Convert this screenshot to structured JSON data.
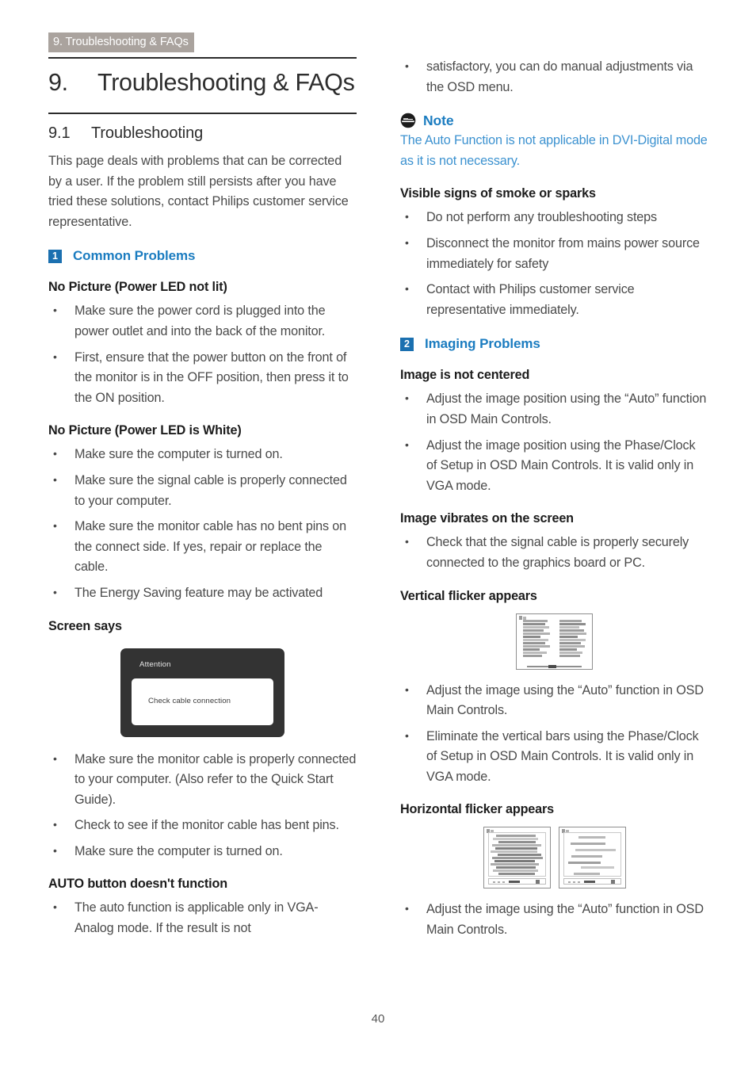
{
  "header": {
    "running_header": "9. Troubleshooting & FAQs",
    "chapter_number": "9.",
    "chapter_title": "Troubleshooting & FAQs",
    "section_number": "9.1",
    "section_title": "Troubleshooting"
  },
  "colors": {
    "accent_blue": "#1b7cc0",
    "badge_blue": "#1b70b0",
    "note_body_blue": "#3c92d0",
    "header_band_gray": "#aaa39e",
    "body_text": "#4a4a4a",
    "heading_black": "#1c1c1c",
    "dialog_dark": "#333333"
  },
  "left_column": {
    "intro": "This page deals with problems that can be corrected by a user. If the problem still persists after you have tried these solutions, contact Philips customer service representative.",
    "common_problems": {
      "badge": "1",
      "label": "Common Problems"
    },
    "no_picture_led_not_lit": {
      "heading": "No Picture (Power LED not lit)",
      "bullets": [
        "Make sure the power cord is plugged into the power outlet and into the back of the monitor.",
        "First, ensure that the power button on the front of the monitor is in the OFF position, then press it to the ON position."
      ]
    },
    "no_picture_led_white": {
      "heading": "No Picture (Power LED is White)",
      "bullets": [
        "Make sure the computer is turned on.",
        "Make sure the signal cable is properly connected to your computer.",
        "Make sure the monitor cable has no bent pins on the connect side. If yes, repair or replace the cable.",
        "The Energy Saving feature may be activated"
      ]
    },
    "screen_says": {
      "heading": "Screen says",
      "dialog": {
        "title": "Attention",
        "message": "Check cable connection"
      },
      "bullets": [
        "Make sure the monitor cable is properly connected to your computer. (Also refer to the Quick Start Guide).",
        "Check to see if the monitor cable has bent pins.",
        "Make sure the computer is turned on."
      ]
    },
    "auto_button": {
      "heading": "AUTO button doesn't function",
      "bullets": [
        "The auto function is applicable only in VGA-Analog mode. If the result is not"
      ]
    }
  },
  "right_column": {
    "continuation": "satisfactory, you can do manual adjustments via the OSD menu.",
    "note": {
      "icon": "note-icon",
      "label": "Note",
      "body": "The Auto Function is not applicable in DVI-Digital mode as it is not necessary."
    },
    "smoke_sparks": {
      "heading": "Visible signs of smoke or sparks",
      "bullets": [
        "Do not perform any troubleshooting steps",
        "Disconnect the monitor from mains power source immediately for safety",
        "Contact with Philips customer service representative immediately."
      ]
    },
    "imaging_problems": {
      "badge": "2",
      "label": "Imaging Problems"
    },
    "image_not_centered": {
      "heading": "Image is not centered",
      "bullets": [
        "Adjust the image position using the “Auto” function in OSD Main Controls.",
        "Adjust the image position using the Phase/Clock of Setup in OSD Main Controls. It is valid only in VGA mode."
      ]
    },
    "image_vibrates": {
      "heading": "Image vibrates on the screen",
      "bullets": [
        "Check that the signal cable is properly securely connected to the graphics board or PC."
      ]
    },
    "vertical_flicker": {
      "heading": "Vertical flicker appears",
      "figure": "vertical-flicker-figure",
      "bullets": [
        "Adjust the image using the “Auto” function in OSD Main Controls.",
        "Eliminate the vertical bars using the Phase/Clock of Setup in OSD Main Controls. It is valid only in VGA mode."
      ]
    },
    "horizontal_flicker": {
      "heading": "Horizontal flicker appears",
      "figure": "horizontal-flicker-figure",
      "bullets": [
        "Adjust the image using the “Auto” function in OSD Main Controls."
      ]
    }
  },
  "footer": {
    "page_number": "40"
  }
}
